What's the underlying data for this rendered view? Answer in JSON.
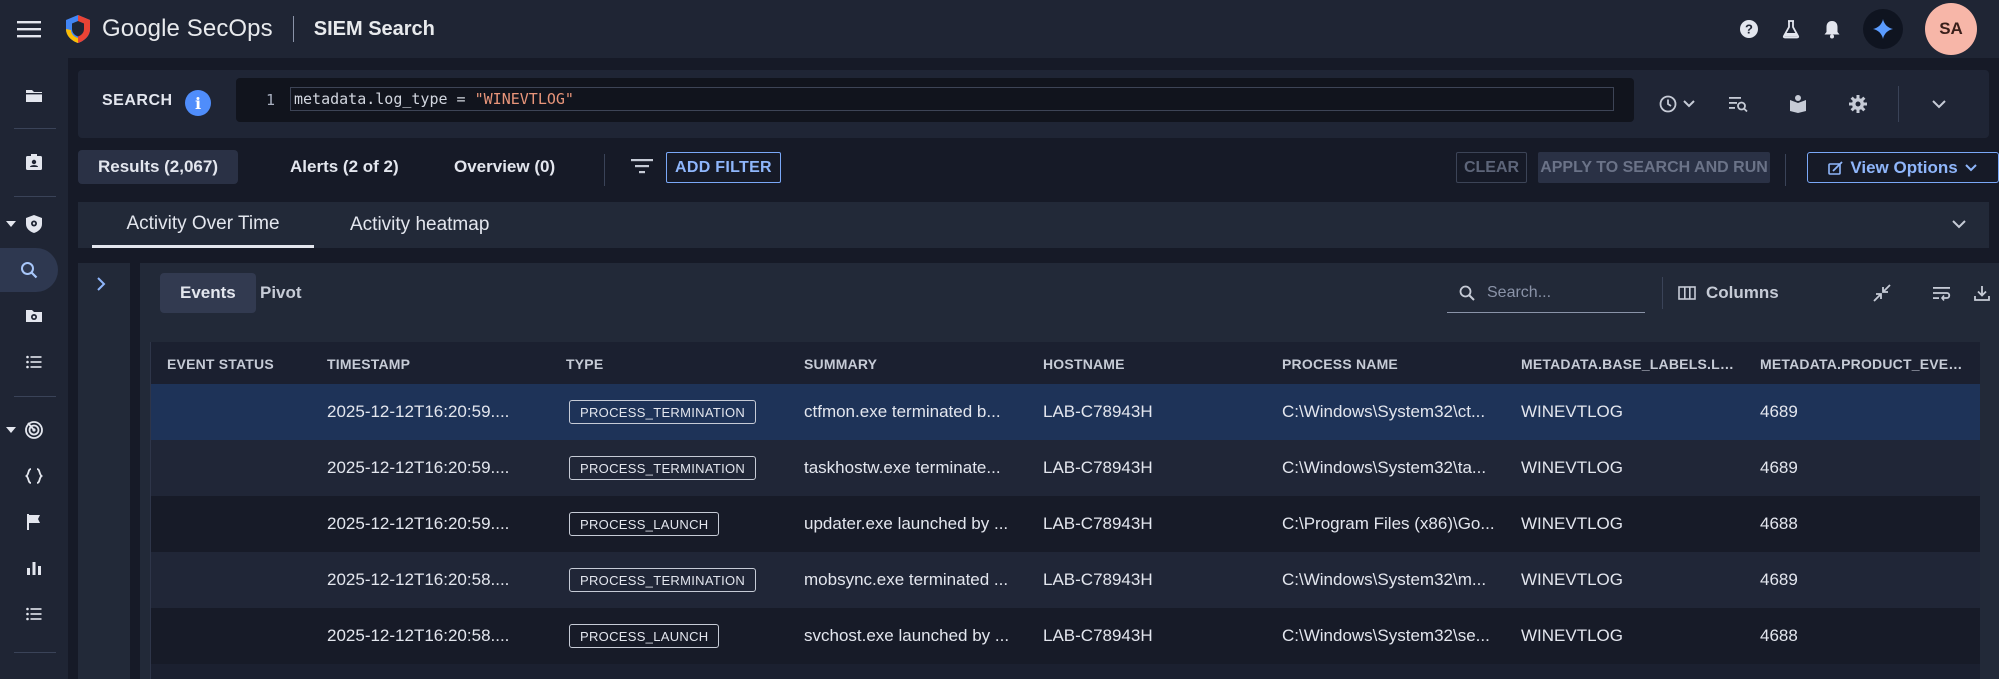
{
  "header": {
    "brand": "Google SecOps",
    "product": "SIEM Search",
    "avatar_initials": "SA",
    "icons": [
      "menu-icon",
      "secops-logo-icon",
      "help-icon",
      "flask-icon",
      "bell-icon",
      "gemini-icon"
    ]
  },
  "sidebar": {
    "items": [
      {
        "icon": "folder-icon"
      },
      {
        "icon": "case-icon"
      },
      {
        "icon": "shield-icon"
      },
      {
        "icon": "search-icon",
        "active": true
      },
      {
        "icon": "camera-folder-icon"
      },
      {
        "icon": "list-icon"
      },
      {
        "icon": "radar-icon"
      },
      {
        "icon": "braces-icon"
      },
      {
        "icon": "flag-icon"
      },
      {
        "icon": "bar-chart-icon"
      },
      {
        "icon": "list-icon"
      }
    ]
  },
  "search": {
    "label": "SEARCH",
    "line_number": "1",
    "query_prefix": "metadata.log_type = ",
    "query_value": "\"WINEVTLOG\""
  },
  "results_tabs": {
    "results": "Results (2,067)",
    "alerts": "Alerts (2 of 2)",
    "overview": "Overview (0)",
    "add_filter": "ADD FILTER",
    "clear": "CLEAR",
    "apply": "APPLY TO SEARCH AND RUN",
    "view_options": "View Options"
  },
  "activity_tabs": {
    "over_time": "Activity Over Time",
    "heatmap": "Activity heatmap"
  },
  "events_panel": {
    "events_tab": "Events",
    "pivot_tab": "Pivot",
    "search_placeholder": "Search...",
    "columns_label": "Columns"
  },
  "table": {
    "columns": [
      "EVENT STATUS",
      "TIMESTAMP",
      "TYPE",
      "SUMMARY",
      "HOSTNAME",
      "PROCESS NAME",
      "METADATA.BASE_LABELS.LO...",
      "METADATA.PRODUCT_EVENT..."
    ],
    "rows": [
      {
        "status": "",
        "timestamp": "2025-12-12T16:20:59....",
        "type": "PROCESS_TERMINATION",
        "summary": "ctfmon.exe terminated b...",
        "hostname": "LAB-C78943H",
        "process": "C:\\Windows\\System32\\ct...",
        "base_labels": "WINEVTLOG",
        "product_event": "4689"
      },
      {
        "status": "",
        "timestamp": "2025-12-12T16:20:59....",
        "type": "PROCESS_TERMINATION",
        "summary": "taskhostw.exe terminate...",
        "hostname": "LAB-C78943H",
        "process": "C:\\Windows\\System32\\ta...",
        "base_labels": "WINEVTLOG",
        "product_event": "4689"
      },
      {
        "status": "",
        "timestamp": "2025-12-12T16:20:59....",
        "type": "PROCESS_LAUNCH",
        "summary": "updater.exe launched by ...",
        "hostname": "LAB-C78943H",
        "process": "C:\\Program Files (x86)\\Go...",
        "base_labels": "WINEVTLOG",
        "product_event": "4688"
      },
      {
        "status": "",
        "timestamp": "2025-12-12T16:20:58....",
        "type": "PROCESS_TERMINATION",
        "summary": "mobsync.exe terminated ...",
        "hostname": "LAB-C78943H",
        "process": "C:\\Windows\\System32\\m...",
        "base_labels": "WINEVTLOG",
        "product_event": "4689"
      },
      {
        "status": "",
        "timestamp": "2025-12-12T16:20:58....",
        "type": "PROCESS_LAUNCH",
        "summary": "svchost.exe launched by ...",
        "hostname": "LAB-C78943H",
        "process": "C:\\Windows\\System32\\se...",
        "base_labels": "WINEVTLOG",
        "product_event": "4688"
      }
    ]
  },
  "colors": {
    "accent": "#7aa8f7",
    "selected_row": "#1e3358",
    "info_blue": "#4f8dfb",
    "avatar": "#f7b6a8"
  }
}
